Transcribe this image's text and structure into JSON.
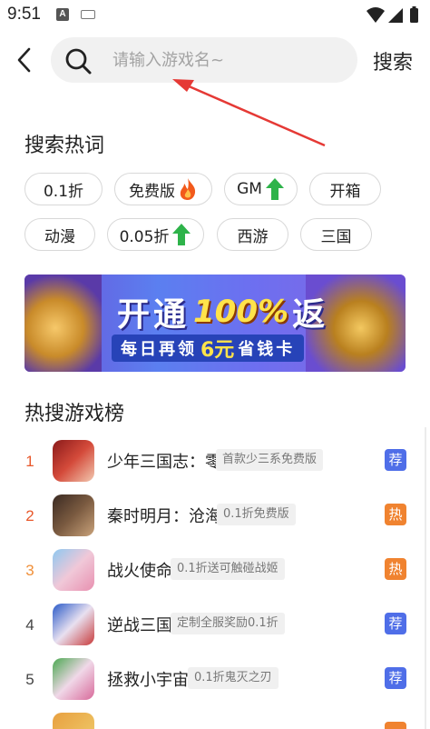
{
  "status_bar": {
    "time": "9:51",
    "notification_icons": [
      "a-icon",
      "keyboard-icon"
    ],
    "system_icons": [
      "wifi-icon",
      "signal-icon",
      "battery-icon"
    ]
  },
  "header": {
    "back_icon": "chevron-left-icon",
    "search_icon": "search-icon",
    "search_placeholder": "请输入游戏名~",
    "search_button": "搜索"
  },
  "hot_words": {
    "title": "搜索热词",
    "chips": [
      {
        "label": "0.1折",
        "icon": null
      },
      {
        "label": "免费版",
        "icon": "fire-icon"
      },
      {
        "label": "GM",
        "icon": "arrow-up-icon"
      },
      {
        "label": "开箱",
        "icon": null
      },
      {
        "label": "动漫",
        "icon": null
      },
      {
        "label": "0.05折",
        "icon": "arrow-up-icon"
      },
      {
        "label": "西游",
        "icon": null
      },
      {
        "label": "三国",
        "icon": null
      }
    ]
  },
  "banner": {
    "line1_a": "开通",
    "line1_pct": "100%",
    "line1_b": "返",
    "line2_a": "每日再领",
    "line2_amount": "6元",
    "line2_b": "省钱卡"
  },
  "ranking": {
    "title": "热搜游戏榜",
    "items": [
      {
        "rank": "1",
        "name": "少年三国志：零",
        "tag": "首款少三系免费版",
        "badge": "荐",
        "badge_type": "recommend",
        "rank_color": "#e8582b"
      },
      {
        "rank": "2",
        "name": "秦时明月：沧海",
        "tag": "0.1折免费版",
        "badge": "热",
        "badge_type": "hot",
        "rank_color": "#e8582b"
      },
      {
        "rank": "3",
        "name": "战火使命",
        "tag": "0.1折送可触碰战姬",
        "badge": "热",
        "badge_type": "hot",
        "rank_color": "#f0903a"
      },
      {
        "rank": "4",
        "name": "逆战三国",
        "tag": "定制全服奖励0.1折",
        "badge": "荐",
        "badge_type": "recommend",
        "rank_color": "#444444"
      },
      {
        "rank": "5",
        "name": "拯救小宇宙",
        "tag": "0.1折鬼灭之刃",
        "badge": "荐",
        "badge_type": "recommend",
        "rank_color": "#444444"
      }
    ]
  },
  "colors": {
    "badge_recommend": "#4f6ee8",
    "badge_hot": "#f08330",
    "arrow_annotation": "#e53935",
    "fire": "#f25a1c",
    "arrow_up": "#2eb34a"
  }
}
